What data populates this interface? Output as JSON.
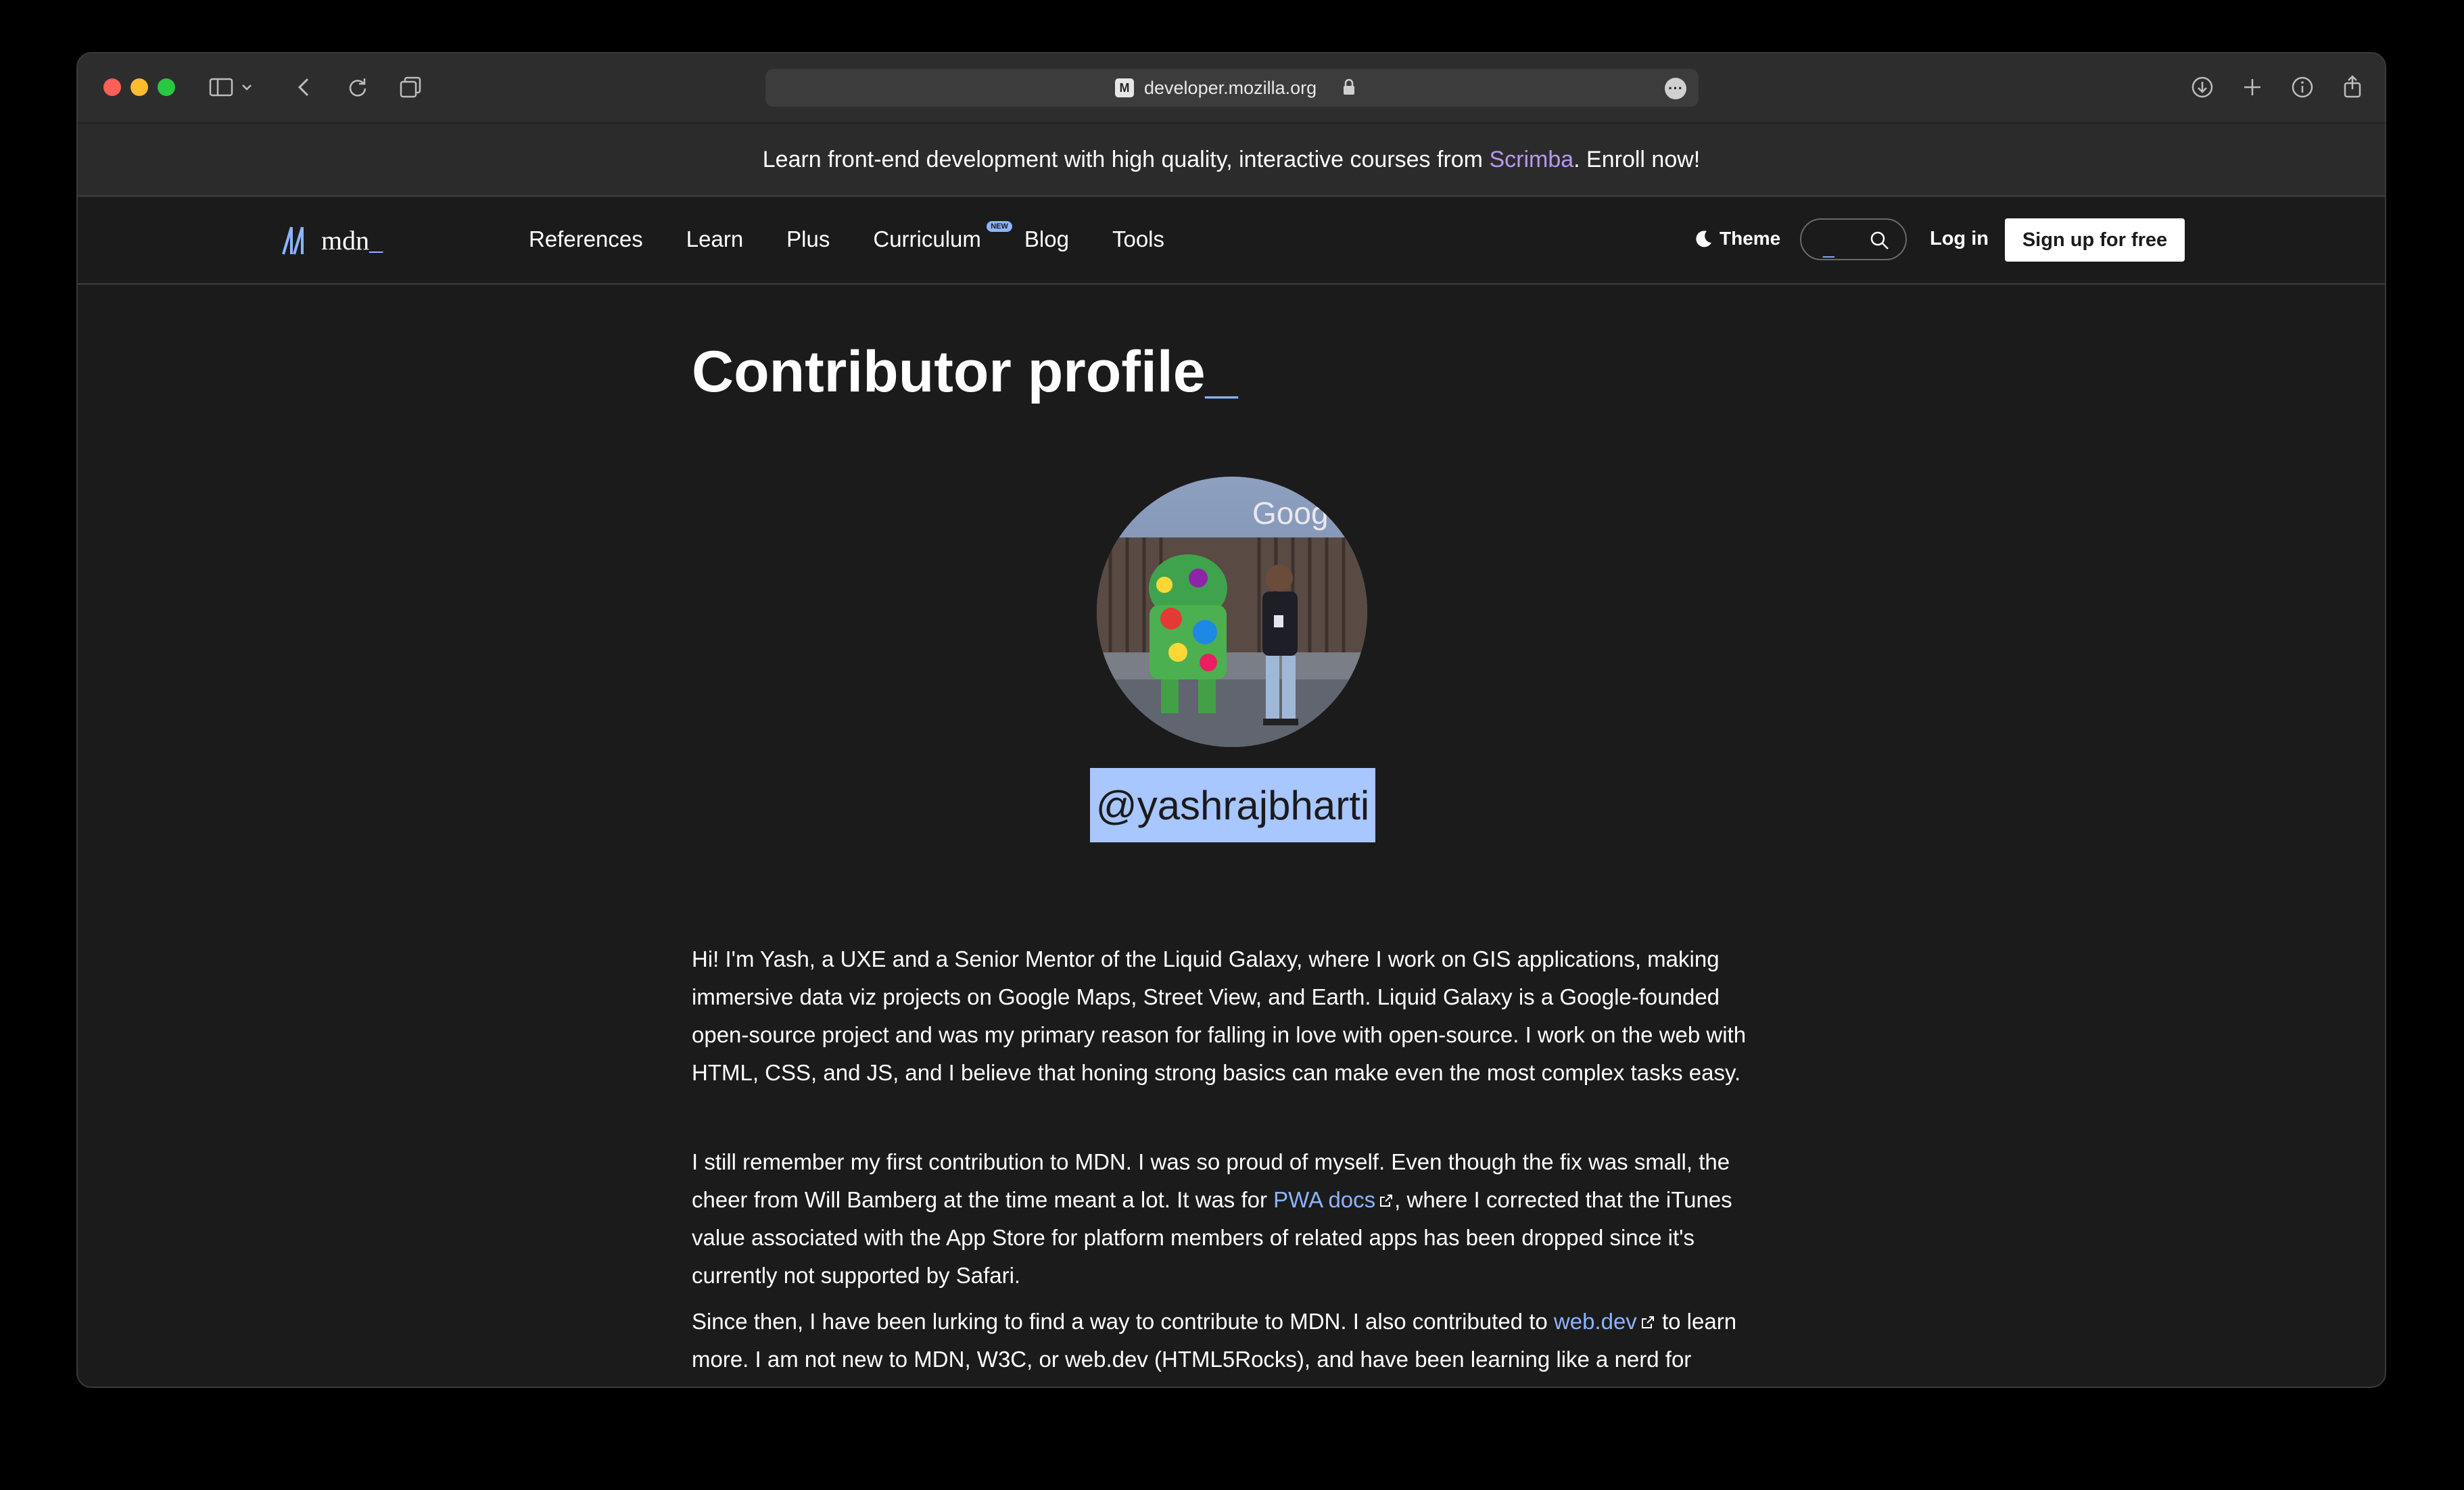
{
  "browser": {
    "url": "developer.mozilla.org",
    "favicon_glyph": "M"
  },
  "banner": {
    "prefix": "Learn front-end development with high quality, interactive courses from ",
    "link": "Scrimba",
    "suffix": ". Enroll now!"
  },
  "nav": {
    "logo_text": "mdn",
    "logo_underscore": "_",
    "items": [
      {
        "label": "References"
      },
      {
        "label": "Learn"
      },
      {
        "label": "Plus"
      },
      {
        "label": "Curriculum",
        "badge": "NEW"
      },
      {
        "label": "Blog"
      },
      {
        "label": "Tools"
      }
    ],
    "theme_label": "Theme",
    "search_cursor": "_",
    "login_label": "Log in",
    "signup_label": "Sign up for free"
  },
  "page": {
    "title": "Contributor profile",
    "title_cursor": "_",
    "handle": "@yashrajbharti",
    "p1": "Hi! I'm Yash, a UXE and a Senior Mentor of the Liquid Galaxy, where I work on GIS applications, making immersive data viz projects on Google Maps, Street View, and Earth. Liquid Galaxy is a Google-founded open-source project and was my primary reason for falling in love with open-source. I work on the web with HTML, CSS, and JS, and I believe that honing strong basics can make even the most complex tasks easy.",
    "p2_a": "I still remember my first contribution to MDN. I was so proud of myself. Even though the fix was small, the cheer from Will Bamberg at the time meant a lot. It was for ",
    "p2_link": "PWA docs",
    "p2_b": ", where I corrected that the iTunes value associated with the App Store for platform members of related apps has been dropped since it's currently not supported by Safari.",
    "p3_a": "Since then, I have been lurking to find a way to contribute to MDN. I also contributed to ",
    "p3_link": "web.dev",
    "p3_b": " to learn more. I am not new to MDN, W3C, or web.dev (HTML5Rocks), and have been learning like a nerd for"
  },
  "colors": {
    "accent": "#8cb4ff",
    "banner_link": "#b699ef",
    "background": "#1b1b1b"
  }
}
